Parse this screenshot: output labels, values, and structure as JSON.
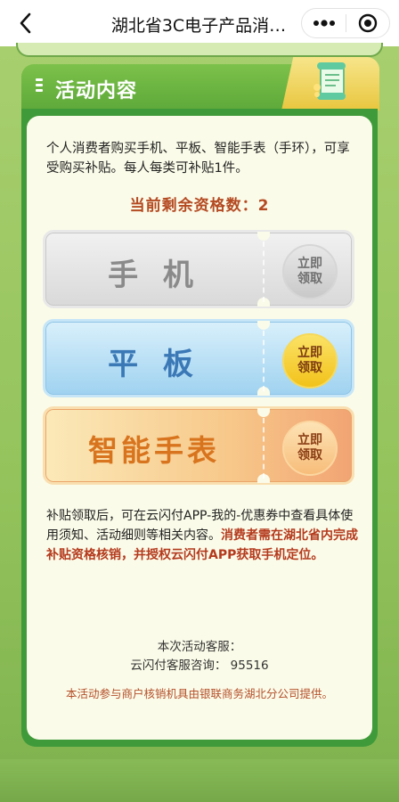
{
  "nav": {
    "title": "湖北省3C电子产品消…"
  },
  "section": {
    "title": "活动内容"
  },
  "intro": "个人消费者购买手机、平板、智能手表（手环），可享受购买补贴。每人每类可补贴1件。",
  "quota": {
    "label": "当前剩余资格数：",
    "value": "2"
  },
  "tickets": [
    {
      "name": "手 机",
      "claim": "立即领取"
    },
    {
      "name": "平 板",
      "claim": "立即领取"
    },
    {
      "name": "智能手表",
      "claim": "立即领取"
    }
  ],
  "description": {
    "normal": "补贴领取后，可在云闪付APP-我的-优惠券中查看具体使用须知、活动细则等相关内容。",
    "highlight": "消费者需在湖北省内完成补贴资格核销，并授权云闪付APP获取手机定位。"
  },
  "service": {
    "line1": "本次活动客服：",
    "line2": "云闪付客服咨询：  95516"
  },
  "provider": "本活动参与商户核销机具由银联商务湖北分公司提供。",
  "colors": {
    "accent_red": "#b44a22",
    "header_green": "#5da93a",
    "tablet_blue": "#3a78b6",
    "watch_orange": "#d8741e"
  },
  "icons": [
    "back-arrow-icon",
    "more-dots-icon",
    "close-target-icon",
    "list-lines-icon",
    "scroll-document-icon"
  ]
}
